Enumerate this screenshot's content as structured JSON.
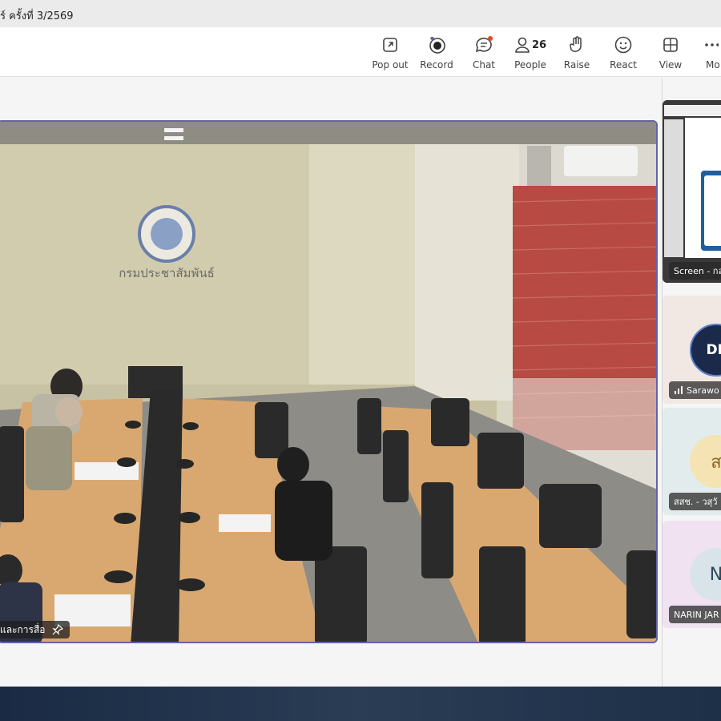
{
  "window": {
    "title": "ร์ ครั้งที่ 3/2569"
  },
  "toolbar": {
    "popout": "Pop out",
    "record": "Record",
    "chat": "Chat",
    "people": "People",
    "people_count": "26",
    "raise": "Raise",
    "react": "React",
    "view": "View",
    "more": "Mo"
  },
  "main_video": {
    "participant_label": "และการสื่อ",
    "wall_text": "กรมประชาสัมพันธ์"
  },
  "side_tiles": [
    {
      "label": "Screen - กล"
    },
    {
      "label": "Sarawo",
      "logo_text": "DL"
    },
    {
      "label": "สสช. - วสุวั",
      "avatar": "ส"
    },
    {
      "label": "NARIN JAR",
      "avatar": "N"
    }
  ],
  "colors": {
    "accent": "#6264a7",
    "chat_dot": "#e64a19"
  }
}
